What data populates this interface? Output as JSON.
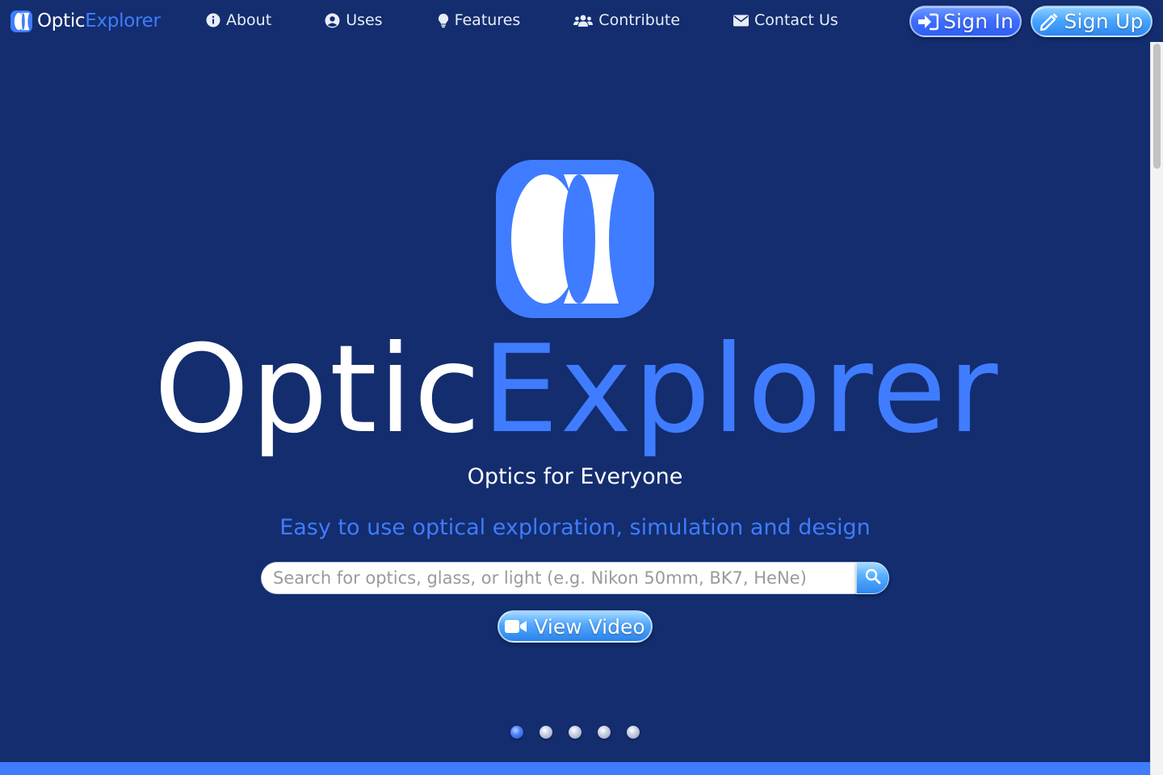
{
  "brand": {
    "name_part1": "Optic",
    "name_part2": "Explorer"
  },
  "nav": {
    "items": [
      {
        "label": "About",
        "icon": "info-circle-icon"
      },
      {
        "label": "Uses",
        "icon": "user-circle-icon"
      },
      {
        "label": "Features",
        "icon": "lightbulb-icon"
      },
      {
        "label": "Contribute",
        "icon": "users-icon"
      },
      {
        "label": "Contact Us",
        "icon": "envelope-icon"
      }
    ],
    "sign_in": "Sign In",
    "sign_up": "Sign Up"
  },
  "hero": {
    "title_part1": "Optic",
    "title_part2": "Explorer",
    "tagline": "Optics for Everyone",
    "subline": "Easy to use optical exploration, simulation and design",
    "search_placeholder": "Search for optics, glass, or light (e.g. Nikon 50mm, BK7, HeNe)",
    "video_button": "View Video"
  },
  "carousel": {
    "slide_count": 5,
    "active_index": 0
  },
  "colors": {
    "background": "#132d6e",
    "accent": "#3f7cff",
    "text": "#ffffff"
  }
}
